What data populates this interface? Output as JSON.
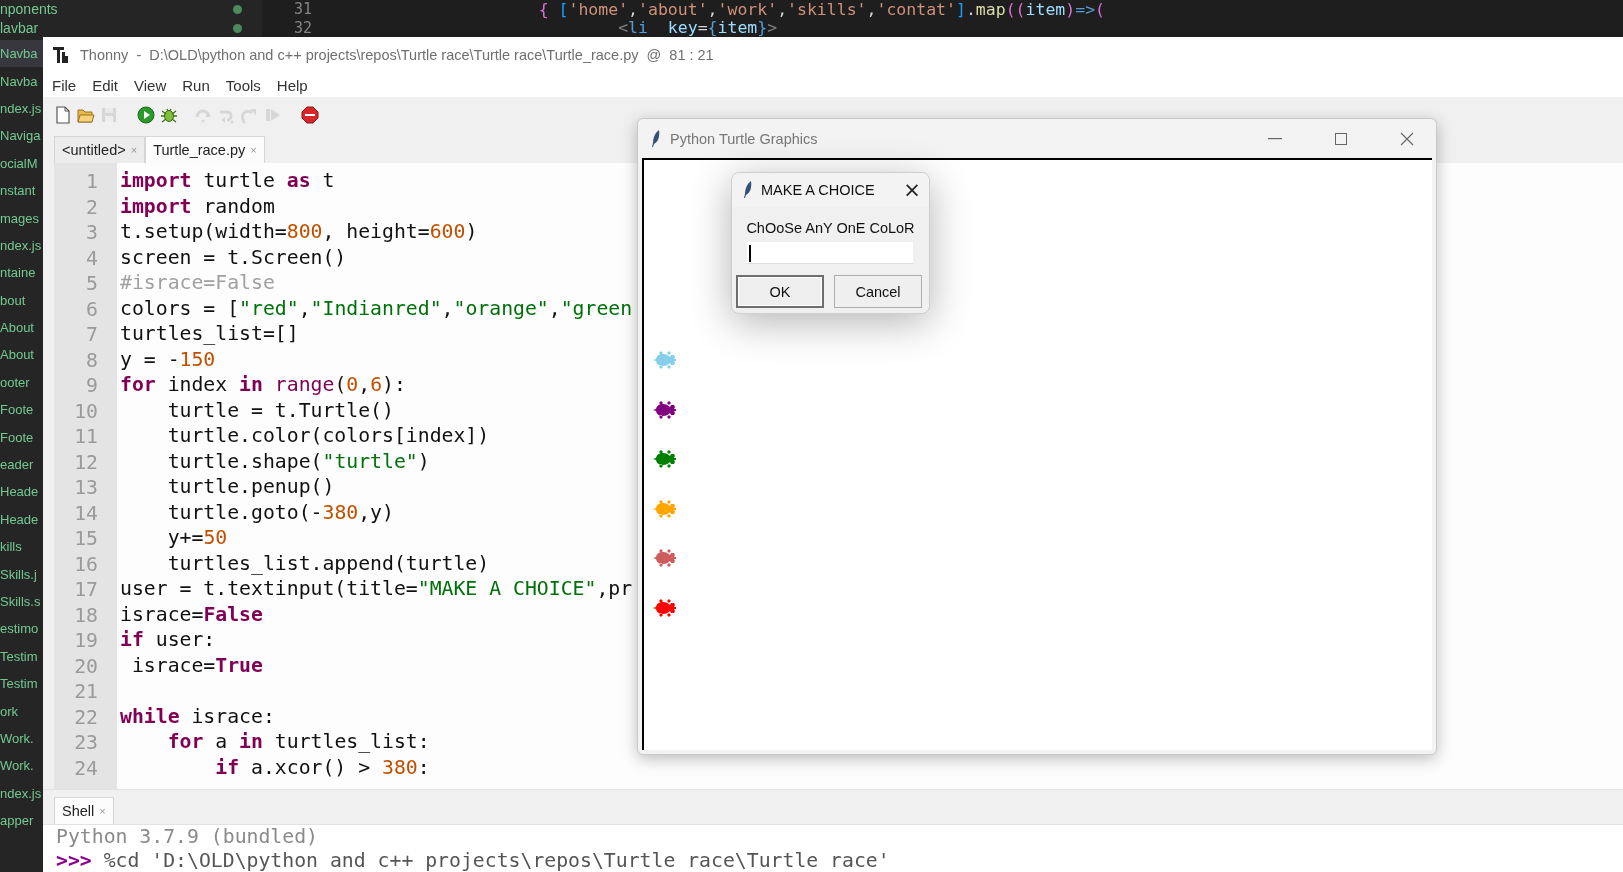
{
  "vscode": {
    "explorer_items": [
      {
        "label": "nponents",
        "marked": true,
        "selected": false
      },
      {
        "label": "lavbar",
        "marked": true,
        "selected": false
      }
    ],
    "editor_lines": [
      {
        "number": "31",
        "tokens": [
          {
            "kind": "brace",
            "text": "                    { "
          },
          {
            "kind": "bracket",
            "text": "["
          },
          {
            "kind": "string",
            "text": "'home'"
          },
          {
            "kind": "plain",
            "text": ","
          },
          {
            "kind": "string",
            "text": "'about'"
          },
          {
            "kind": "plain",
            "text": ","
          },
          {
            "kind": "string",
            "text": "'work'"
          },
          {
            "kind": "plain",
            "text": ","
          },
          {
            "kind": "string",
            "text": "'skills'"
          },
          {
            "kind": "plain",
            "text": ","
          },
          {
            "kind": "string",
            "text": "'contat'"
          },
          {
            "kind": "bracket",
            "text": "]"
          },
          {
            "kind": "plain",
            "text": "."
          },
          {
            "kind": "function",
            "text": "map"
          },
          {
            "kind": "brace",
            "text": "(("
          },
          {
            "kind": "variable",
            "text": "item"
          },
          {
            "kind": "brace",
            "text": ")"
          },
          {
            "kind": "operator",
            "text": "=>"
          },
          {
            "kind": "brace",
            "text": "("
          }
        ]
      },
      {
        "number": "32",
        "tokens": [
          {
            "kind": "punctuation",
            "text": "                            <"
          },
          {
            "kind": "tag",
            "text": "li"
          },
          {
            "kind": "variable",
            "text": "  key"
          },
          {
            "kind": "plain",
            "text": "="
          },
          {
            "kind": "operator",
            "text": "{"
          },
          {
            "kind": "variable",
            "text": "item"
          },
          {
            "kind": "operator",
            "text": "}"
          },
          {
            "kind": "punctuation",
            "text": ">"
          }
        ]
      }
    ],
    "sidebar_items": [
      {
        "label": "Navba",
        "selected": true
      },
      {
        "label": "Navba",
        "selected": false
      },
      {
        "label": "ndex.js",
        "selected": false
      },
      {
        "label": "Naviga",
        "selected": false
      },
      {
        "label": "ocialM",
        "selected": false
      },
      {
        "label": "nstant",
        "selected": false
      },
      {
        "label": "mages",
        "selected": false
      },
      {
        "label": "ndex.js",
        "selected": false
      },
      {
        "label": "ntaine",
        "selected": false
      },
      {
        "label": "bout",
        "selected": false
      },
      {
        "label": "About",
        "selected": false
      },
      {
        "label": "About",
        "selected": false
      },
      {
        "label": "ooter",
        "selected": false
      },
      {
        "label": "Foote",
        "selected": false
      },
      {
        "label": "Foote",
        "selected": false
      },
      {
        "label": "eader",
        "selected": false
      },
      {
        "label": "Heade",
        "selected": false
      },
      {
        "label": "Heade",
        "selected": false
      },
      {
        "label": "kills",
        "selected": false
      },
      {
        "label": "Skills.j",
        "selected": false
      },
      {
        "label": "Skills.s",
        "selected": false
      },
      {
        "label": "estimo",
        "selected": false
      },
      {
        "label": "Testim",
        "selected": false
      },
      {
        "label": "Testim",
        "selected": false
      },
      {
        "label": "ork",
        "selected": false
      },
      {
        "label": "Work.",
        "selected": false
      },
      {
        "label": "Work.",
        "selected": false
      },
      {
        "label": "ndex.js",
        "selected": false
      },
      {
        "label": "apper",
        "selected": false
      }
    ]
  },
  "thonny": {
    "title": "Thonny  -  D:\\OLD\\python and c++ projects\\repos\\Turtle race\\Turtle race\\Turtle_race.py  @  81 : 21",
    "menu": [
      "File",
      "Edit",
      "View",
      "Run",
      "Tools",
      "Help"
    ],
    "toolbar": [
      {
        "kind": "new",
        "disabled": false
      },
      {
        "kind": "open",
        "disabled": false
      },
      {
        "kind": "save",
        "disabled": true
      },
      {
        "kind": "run",
        "disabled": false
      },
      {
        "kind": "debug",
        "disabled": false
      },
      {
        "kind": "step_over",
        "disabled": true
      },
      {
        "kind": "step_into",
        "disabled": true
      },
      {
        "kind": "step_out",
        "disabled": true
      },
      {
        "kind": "resume",
        "disabled": true
      },
      {
        "kind": "stop",
        "disabled": false
      }
    ],
    "tabs": [
      {
        "label": "<untitled>",
        "close": "×",
        "selected": false
      },
      {
        "label": "Turtle_race.py",
        "close": "×",
        "selected": true
      }
    ],
    "code_lines": [
      {
        "number": "1",
        "tokens": [
          {
            "kind": "keyword",
            "text": "import"
          },
          {
            "kind": "plain",
            "text": " turtle "
          },
          {
            "kind": "keyword",
            "text": "as"
          },
          {
            "kind": "plain",
            "text": " t"
          }
        ]
      },
      {
        "number": "2",
        "tokens": [
          {
            "kind": "keyword",
            "text": "import"
          },
          {
            "kind": "plain",
            "text": " random"
          }
        ]
      },
      {
        "number": "3",
        "tokens": [
          {
            "kind": "plain",
            "text": "t.setup(width="
          },
          {
            "kind": "number",
            "text": "800"
          },
          {
            "kind": "plain",
            "text": ", height="
          },
          {
            "kind": "number",
            "text": "600"
          },
          {
            "kind": "plain",
            "text": ")"
          }
        ]
      },
      {
        "number": "4",
        "tokens": [
          {
            "kind": "plain",
            "text": "screen = t.Screen()"
          }
        ]
      },
      {
        "number": "5",
        "tokens": [
          {
            "kind": "comment",
            "text": "#israce=False"
          }
        ]
      },
      {
        "number": "6",
        "tokens": [
          {
            "kind": "plain",
            "text": "colors = ["
          },
          {
            "kind": "string",
            "text": "\"red\""
          },
          {
            "kind": "plain",
            "text": ","
          },
          {
            "kind": "string",
            "text": "\"Indianred\""
          },
          {
            "kind": "plain",
            "text": ","
          },
          {
            "kind": "string",
            "text": "\"orange\""
          },
          {
            "kind": "plain",
            "text": ","
          },
          {
            "kind": "string",
            "text": "\"green"
          }
        ]
      },
      {
        "number": "7",
        "tokens": [
          {
            "kind": "plain",
            "text": "turtles_list=[]"
          }
        ]
      },
      {
        "number": "8",
        "tokens": [
          {
            "kind": "plain",
            "text": "y = -"
          },
          {
            "kind": "number",
            "text": "150"
          }
        ]
      },
      {
        "number": "9",
        "tokens": [
          {
            "kind": "keyword",
            "text": "for"
          },
          {
            "kind": "plain",
            "text": " index "
          },
          {
            "kind": "keyword",
            "text": "in"
          },
          {
            "kind": "builtin",
            "text": " range"
          },
          {
            "kind": "plain",
            "text": "("
          },
          {
            "kind": "number",
            "text": "0"
          },
          {
            "kind": "plain",
            "text": ","
          },
          {
            "kind": "number",
            "text": "6"
          },
          {
            "kind": "plain",
            "text": "):"
          }
        ]
      },
      {
        "number": "10",
        "tokens": [
          {
            "kind": "plain",
            "text": "    turtle = t.Turtle()"
          }
        ]
      },
      {
        "number": "11",
        "tokens": [
          {
            "kind": "plain",
            "text": "    turtle.color(colors[index])"
          }
        ]
      },
      {
        "number": "12",
        "tokens": [
          {
            "kind": "plain",
            "text": "    turtle.shape("
          },
          {
            "kind": "string",
            "text": "\"turtle\""
          },
          {
            "kind": "plain",
            "text": ")"
          }
        ]
      },
      {
        "number": "13",
        "tokens": [
          {
            "kind": "plain",
            "text": "    turtle.penup()"
          }
        ]
      },
      {
        "number": "14",
        "tokens": [
          {
            "kind": "plain",
            "text": "    turtle.goto(-"
          },
          {
            "kind": "number",
            "text": "380"
          },
          {
            "kind": "plain",
            "text": ",y)"
          }
        ]
      },
      {
        "number": "15",
        "tokens": [
          {
            "kind": "plain",
            "text": "    y+="
          },
          {
            "kind": "number",
            "text": "50"
          }
        ]
      },
      {
        "number": "16",
        "tokens": [
          {
            "kind": "plain",
            "text": "    turtles_list.append(turtle)"
          }
        ]
      },
      {
        "number": "17",
        "tokens": [
          {
            "kind": "plain",
            "text": "user = t.textinput(title="
          },
          {
            "kind": "string",
            "text": "\"MAKE A CHOICE\""
          },
          {
            "kind": "plain",
            "text": ",pr"
          }
        ]
      },
      {
        "number": "18",
        "tokens": [
          {
            "kind": "plain",
            "text": "israce="
          },
          {
            "kind": "keyword",
            "text": "False"
          }
        ]
      },
      {
        "number": "19",
        "tokens": [
          {
            "kind": "keyword",
            "text": "if"
          },
          {
            "kind": "plain",
            "text": " user:"
          }
        ]
      },
      {
        "number": "20",
        "tokens": [
          {
            "kind": "plain",
            "text": " israce="
          },
          {
            "kind": "keyword",
            "text": "True"
          }
        ]
      },
      {
        "number": "21"
      },
      {
        "number": "22",
        "tokens": [
          {
            "kind": "keyword",
            "text": "while"
          },
          {
            "kind": "plain",
            "text": " israce:"
          }
        ]
      },
      {
        "number": "23",
        "tokens": [
          {
            "kind": "keyword",
            "text": "    for"
          },
          {
            "kind": "plain",
            "text": " a "
          },
          {
            "kind": "keyword",
            "text": "in"
          },
          {
            "kind": "plain",
            "text": " turtles_list:"
          }
        ]
      },
      {
        "number": "24",
        "tokens": [
          {
            "kind": "keyword",
            "text": "        if"
          },
          {
            "kind": "plain",
            "text": " a.xcor() > "
          },
          {
            "kind": "number",
            "text": "380"
          },
          {
            "kind": "plain",
            "text": ":"
          }
        ]
      }
    ],
    "shell_tab": {
      "label": "Shell",
      "close": "×"
    },
    "shell_lines": [
      {
        "tokens": [
          {
            "kind": "output",
            "text": "Python 3.7.9 (bundled)"
          }
        ]
      },
      {
        "tokens": [
          {
            "kind": "prompt",
            "text": ">>>"
          },
          {
            "kind": "command",
            "text": " %cd 'D:\\OLD\\python and c++ projects\\repos\\Turtle race\\Turtle race'"
          }
        ]
      }
    ]
  },
  "turtle_window": {
    "title": "Python Turtle Graphics",
    "turtles": [
      {
        "color": "#87ceeb"
      },
      {
        "color": "#800080"
      },
      {
        "color": "#008000"
      },
      {
        "color": "#ffa500"
      },
      {
        "color": "#cd5c5c"
      },
      {
        "color": "#ff0000"
      }
    ]
  },
  "dialog": {
    "title": "MAKE A CHOICE",
    "close": "×",
    "prompt": "ChOoSe AnY OnE CoLoR",
    "input": {
      "focused": true
    },
    "buttons": [
      {
        "label": "OK",
        "default": true
      },
      {
        "label": "Cancel",
        "default": false
      }
    ]
  }
}
